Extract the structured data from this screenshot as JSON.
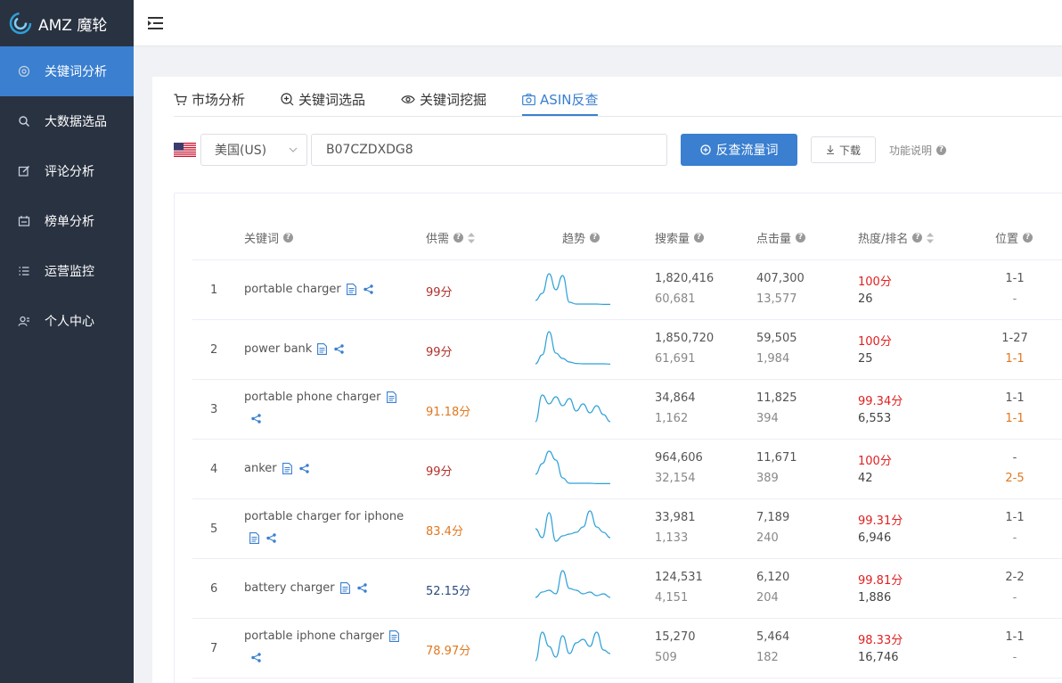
{
  "app": {
    "name": "AMZ 魔轮"
  },
  "colors": {
    "accent": "#3a7fd0",
    "sidebar_bg": "#293241",
    "score_red": "#b0302a",
    "score_orange": "#e07820",
    "score_navy": "#2c4a7c",
    "hot_red": "#e02020",
    "trend_line": "#2ea0d8"
  },
  "sidebar": {
    "items": [
      {
        "label": "关键词分析",
        "icon": "target-icon",
        "active": true
      },
      {
        "label": "大数据选品",
        "icon": "search-icon",
        "active": false
      },
      {
        "label": "评论分析",
        "icon": "edit-icon",
        "active": false
      },
      {
        "label": "榜单分析",
        "icon": "board-icon",
        "active": false
      },
      {
        "label": "运营监控",
        "icon": "list-icon",
        "active": false
      },
      {
        "label": "个人中心",
        "icon": "user-icon",
        "active": false
      }
    ]
  },
  "tabs": [
    {
      "label": "市场分析",
      "icon": "cart-icon",
      "active": false
    },
    {
      "label": "关键词选品",
      "icon": "zoom-in-icon",
      "active": false
    },
    {
      "label": "关键词挖掘",
      "icon": "eye-icon",
      "active": false
    },
    {
      "label": "ASIN反查",
      "icon": "camera-icon",
      "active": true
    }
  ],
  "search": {
    "country": "美国(US)",
    "asin_value": "B07CZDXDG8",
    "submit_label": "反查流量词",
    "download_label": "下载",
    "help_label": "功能说明"
  },
  "table": {
    "headers": {
      "keyword": "关键词",
      "supply": "供需",
      "trend": "趋势",
      "search_volume": "搜索量",
      "clicks": "点击量",
      "heat_rank": "热度/排名",
      "position": "位置"
    },
    "rows": [
      {
        "index": "1",
        "keyword": "portable charger",
        "score": "99分",
        "score_color": "#b0302a",
        "sv": "1,820,416",
        "sv2": "60,681",
        "clicks": "407,300",
        "clicks2": "13,577",
        "heat": "100分",
        "rank": "26",
        "pos1": "1-1",
        "pos2": "-",
        "pos2_orange": false,
        "trend": [
          0.15,
          0.35,
          0.9,
          0.45,
          0.85,
          0.1,
          0.05,
          0.05,
          0.05,
          0.05,
          0.04,
          0.04
        ]
      },
      {
        "index": "2",
        "keyword": "power bank",
        "score": "99分",
        "score_color": "#b0302a",
        "sv": "1,850,720",
        "sv2": "61,691",
        "clicks": "59,505",
        "clicks2": "1,984",
        "heat": "100分",
        "rank": "25",
        "pos1": "1-27",
        "pos2": "1-1",
        "pos2_orange": true,
        "trend": [
          0.05,
          0.3,
          0.95,
          0.35,
          0.2,
          0.1,
          0.06,
          0.05,
          0.05,
          0.05,
          0.05,
          0.04
        ]
      },
      {
        "index": "3",
        "keyword": "portable phone charger",
        "score": "91.18分",
        "score_color": "#e07820",
        "sv": "34,864",
        "sv2": "1,162",
        "clicks": "11,825",
        "clicks2": "394",
        "heat": "99.34分",
        "rank": "6,553",
        "pos1": "1-1",
        "pos2": "1-1",
        "pos2_orange": true,
        "trend": [
          0.1,
          0.85,
          0.6,
          0.8,
          0.55,
          0.75,
          0.4,
          0.6,
          0.35,
          0.55,
          0.3,
          0.1
        ]
      },
      {
        "index": "4",
        "keyword": "anker",
        "score": "99分",
        "score_color": "#b0302a",
        "sv": "964,606",
        "sv2": "32,154",
        "clicks": "11,671",
        "clicks2": "389",
        "heat": "100分",
        "rank": "42",
        "pos1": "-",
        "pos2": "2-5",
        "pos2_orange": true,
        "trend": [
          0.3,
          0.6,
          0.95,
          0.7,
          0.2,
          0.05,
          0.05,
          0.05,
          0.05,
          0.04,
          0.04,
          0.04
        ]
      },
      {
        "index": "5",
        "keyword": "portable charger for iphone",
        "score": "83.4分",
        "score_color": "#e07820",
        "sv": "33,981",
        "sv2": "1,133",
        "clicks": "7,189",
        "clicks2": "240",
        "heat": "99.31分",
        "rank": "6,946",
        "pos1": "1-1",
        "pos2": "-",
        "pos2_orange": false,
        "trend": [
          0.45,
          0.2,
          0.9,
          0.1,
          0.25,
          0.3,
          0.35,
          0.5,
          0.95,
          0.5,
          0.35,
          0.2
        ]
      },
      {
        "index": "6",
        "keyword": "battery charger",
        "score": "52.15分",
        "score_color": "#2c4a7c",
        "sv": "124,531",
        "sv2": "4,151",
        "clicks": "6,120",
        "clicks2": "204",
        "heat": "99.81分",
        "rank": "1,886",
        "pos1": "2-2",
        "pos2": "-",
        "pos2_orange": false,
        "trend": [
          0.2,
          0.35,
          0.4,
          0.3,
          0.95,
          0.45,
          0.4,
          0.3,
          0.35,
          0.25,
          0.3,
          0.2
        ]
      },
      {
        "index": "7",
        "keyword": "portable iphone charger",
        "score": "78.97分",
        "score_color": "#e07820",
        "sv": "15,270",
        "sv2": "509",
        "clicks": "5,464",
        "clicks2": "182",
        "heat": "98.33分",
        "rank": "16,746",
        "pos1": "1-1",
        "pos2": "-",
        "pos2_orange": false,
        "trend": [
          0.1,
          0.9,
          0.5,
          0.2,
          0.8,
          0.3,
          0.6,
          0.7,
          0.5,
          0.9,
          0.4,
          0.3
        ]
      }
    ]
  }
}
